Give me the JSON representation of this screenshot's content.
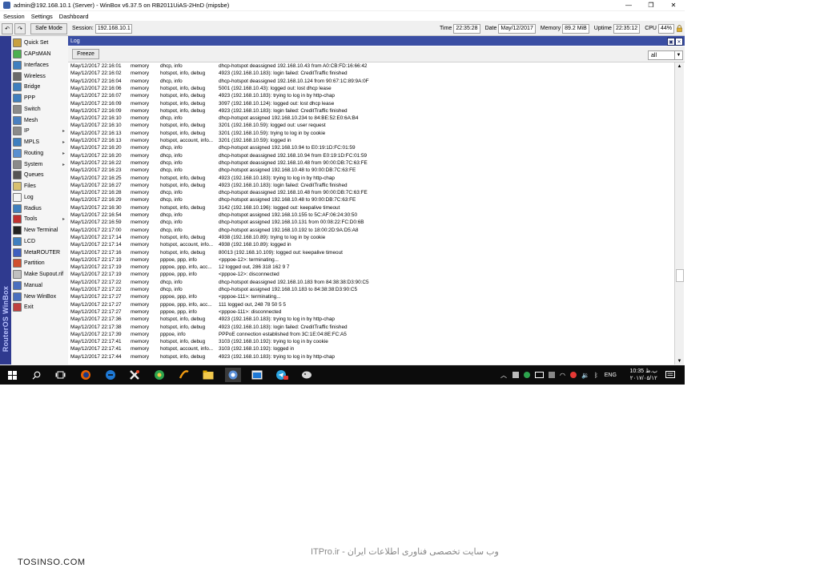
{
  "window": {
    "title": "admin@192.168.10.1 (Server) - WinBox v6.37.5 on RB2011UiAS-2HnD (mipsbe)",
    "min_glyph": "—",
    "max_glyph": "❐",
    "close_glyph": "✕"
  },
  "menubar": [
    "Session",
    "Settings",
    "Dashboard"
  ],
  "toolbar": {
    "undo_glyph": "↶",
    "redo_glyph": "↷",
    "safe_mode": "Safe Mode",
    "session_label": "Session:",
    "session_value": "192.168.10.1",
    "time_label": "Time",
    "time_value": "22:35:28",
    "date_label": "Date",
    "date_value": "May/12/2017",
    "memory_label": "Memory",
    "memory_value": "89.2 MiB",
    "uptime_label": "Uptime",
    "uptime_value": "22:35:12",
    "cpu_label": "CPU",
    "cpu_value": "44%"
  },
  "sidebar": {
    "brand": "RouterOS WinBox",
    "items": [
      {
        "label": "Quick Set",
        "color": "#c8a040",
        "arrow": false
      },
      {
        "label": "CAPsMAN",
        "color": "#4caf50",
        "arrow": false
      },
      {
        "label": "Interfaces",
        "color": "#3f7fbf",
        "arrow": false
      },
      {
        "label": "Wireless",
        "color": "#6a6a6a",
        "arrow": false
      },
      {
        "label": "Bridge",
        "color": "#3f7fbf",
        "arrow": false
      },
      {
        "label": "PPP",
        "color": "#3f7fbf",
        "arrow": false
      },
      {
        "label": "Switch",
        "color": "#8a8a8a",
        "arrow": false
      },
      {
        "label": "Mesh",
        "color": "#4a7fbf",
        "arrow": false
      },
      {
        "label": "IP",
        "color": "#8a8a8a",
        "arrow": true
      },
      {
        "label": "MPLS",
        "color": "#3f7fbf",
        "arrow": true
      },
      {
        "label": "Routing",
        "color": "#5a8fd0",
        "arrow": true
      },
      {
        "label": "System",
        "color": "#8a8a8a",
        "arrow": true
      },
      {
        "label": "Queues",
        "color": "#555555",
        "arrow": false
      },
      {
        "label": "Files",
        "color": "#d8c070",
        "arrow": false
      },
      {
        "label": "Log",
        "color": "#f4f4f4",
        "arrow": false
      },
      {
        "label": "Radius",
        "color": "#3f7fbf",
        "arrow": false
      },
      {
        "label": "Tools",
        "color": "#c03030",
        "arrow": true
      },
      {
        "label": "New Terminal",
        "color": "#222222",
        "arrow": false
      },
      {
        "label": "LCD",
        "color": "#3f7fbf",
        "arrow": false
      },
      {
        "label": "MetaROUTER",
        "color": "#3f5fbf",
        "arrow": false
      },
      {
        "label": "Partition",
        "color": "#d05030",
        "arrow": false
      },
      {
        "label": "Make Supout.rif",
        "color": "#c0c0c0",
        "arrow": false
      },
      {
        "label": "Manual",
        "color": "#4a6fbf",
        "arrow": false
      },
      {
        "label": "New WinBox",
        "color": "#4a6fbf",
        "arrow": false
      },
      {
        "label": "Exit",
        "color": "#c04040",
        "arrow": false
      }
    ]
  },
  "log": {
    "title": "Log",
    "freeze": "Freeze",
    "filter": "all",
    "dropdown_glyph": "▼",
    "restore_glyph": "▣",
    "close_glyph": "✕",
    "scroll_up_glyph": "▲",
    "scroll_down_glyph": "▼",
    "rows": [
      [
        "May/12/2017 22:16:01",
        "memory",
        "dhcp, info",
        "dhcp-hotspot deassigned 192.168.10.43 from A0:CB:FD:16:66:42"
      ],
      [
        "May/12/2017 22:16:02",
        "memory",
        "hotspot, info, debug",
        "4923 (192.168.10.183): login failed: CreditTraffic finished"
      ],
      [
        "May/12/2017 22:16:04",
        "memory",
        "dhcp, info",
        "dhcp-hotspot deassigned 192.168.10.124 from 90:67:1C:89:9A:0F"
      ],
      [
        "May/12/2017 22:16:06",
        "memory",
        "hotspot, info, debug",
        "5001 (192.168.10.43): logged out: lost dhcp lease"
      ],
      [
        "May/12/2017 22:16:07",
        "memory",
        "hotspot, info, debug",
        "4923 (192.168.10.183): trying to log in by http-chap"
      ],
      [
        "May/12/2017 22:16:09",
        "memory",
        "hotspot, info, debug",
        "3097 (192.168.10.124): logged out: lost dhcp lease"
      ],
      [
        "May/12/2017 22:16:09",
        "memory",
        "hotspot, info, debug",
        "4923 (192.168.10.183): login failed: CreditTraffic finished"
      ],
      [
        "May/12/2017 22:16:10",
        "memory",
        "dhcp, info",
        "dhcp-hotspot assigned 192.168.10.234 to 84:BE:52:E0:6A:B4"
      ],
      [
        "May/12/2017 22:16:10",
        "memory",
        "hotspot, info, debug",
        "3201 (192.168.10.59): logged out: user request"
      ],
      [
        "May/12/2017 22:16:13",
        "memory",
        "hotspot, info, debug",
        "3201 (192.168.10.59): trying to log in by cookie"
      ],
      [
        "May/12/2017 22:16:13",
        "memory",
        "hotspot, account, info...",
        "3201 (192.168.10.59): logged in"
      ],
      [
        "May/12/2017 22:16:20",
        "memory",
        "dhcp, info",
        "dhcp-hotspot assigned 192.168.10.94 to E0:19:1D:FC:01:59"
      ],
      [
        "May/12/2017 22:16:20",
        "memory",
        "dhcp, info",
        "dhcp-hotspot deassigned 192.168.10.94 from E0:19:1D:FC:01:59"
      ],
      [
        "May/12/2017 22:16:22",
        "memory",
        "dhcp, info",
        "dhcp-hotspot deassigned 192.168.10.48 from 90:00:DB:7C:63:FE"
      ],
      [
        "May/12/2017 22:16:23",
        "memory",
        "dhcp, info",
        "dhcp-hotspot assigned 192.168.10.48 to 90:00:DB:7C:63:FE"
      ],
      [
        "May/12/2017 22:16:25",
        "memory",
        "hotspot, info, debug",
        "4923 (192.168.10.183): trying to log in by http-chap"
      ],
      [
        "May/12/2017 22:16:27",
        "memory",
        "hotspot, info, debug",
        "4923 (192.168.10.183): login failed: CreditTraffic finished"
      ],
      [
        "May/12/2017 22:16:28",
        "memory",
        "dhcp, info",
        "dhcp-hotspot deassigned 192.168.10.48 from 90:00:DB:7C:63:FE"
      ],
      [
        "May/12/2017 22:16:29",
        "memory",
        "dhcp, info",
        "dhcp-hotspot assigned 192.168.10.48 to 90:00:DB:7C:63:FE"
      ],
      [
        "May/12/2017 22:16:30",
        "memory",
        "hotspot, info, debug",
        "3142 (192.168.10.196): logged out: keepalive timeout"
      ],
      [
        "May/12/2017 22:16:54",
        "memory",
        "dhcp, info",
        "dhcp-hotspot assigned 192.168.10.155 to 5C:AF:06:24:30:50"
      ],
      [
        "May/12/2017 22:16:59",
        "memory",
        "dhcp, info",
        "dhcp-hotspot assigned 192.168.10.131 from 00:08:22:FC:D0:6B"
      ],
      [
        "May/12/2017 22:17:00",
        "memory",
        "dhcp, info",
        "dhcp-hotspot assigned 192.168.10.192 to 18:00:2D:9A:D5:A8"
      ],
      [
        "May/12/2017 22:17:14",
        "memory",
        "hotspot, info, debug",
        "4938 (192.168.10.89): trying to log in by cookie"
      ],
      [
        "May/12/2017 22:17:14",
        "memory",
        "hotspot, account, info...",
        "4938 (192.168.10.89): logged in"
      ],
      [
        "May/12/2017 22:17:16",
        "memory",
        "hotspot, info, debug",
        "80013 (192.168.10.109): logged out: keepalive timeout"
      ],
      [
        "May/12/2017 22:17:19",
        "memory",
        "pppoe, ppp, info",
        "<pppoe-12>: terminating..."
      ],
      [
        "May/12/2017 22:17:19",
        "memory",
        "pppoe, ppp, info, acc...",
        "12 logged out, 286 318 162 9 7"
      ],
      [
        "May/12/2017 22:17:19",
        "memory",
        "pppoe, ppp, info",
        "<pppoe-12>: disconnected"
      ],
      [
        "May/12/2017 22:17:22",
        "memory",
        "dhcp, info",
        "dhcp-hotspot deassigned 192.168.10.183 from 84:38:38:D3:90:C5"
      ],
      [
        "May/12/2017 22:17:22",
        "memory",
        "dhcp, info",
        "dhcp-hotspot assigned 192.168.10.183 to 84:38:38:D3:90:C5"
      ],
      [
        "May/12/2017 22:17:27",
        "memory",
        "pppoe, ppp, info",
        "<pppoe-111>: terminating..."
      ],
      [
        "May/12/2017 22:17:27",
        "memory",
        "pppoe, ppp, info, acc...",
        "111 logged out, 248 78 50 5 5"
      ],
      [
        "May/12/2017 22:17:27",
        "memory",
        "pppoe, ppp, info",
        "<pppoe-111>: disconnected"
      ],
      [
        "May/12/2017 22:17:36",
        "memory",
        "hotspot, info, debug",
        "4923 (192.168.10.183): trying to log in by http-chap"
      ],
      [
        "May/12/2017 22:17:38",
        "memory",
        "hotspot, info, debug",
        "4923 (192.168.10.183): login failed: CreditTraffic finished"
      ],
      [
        "May/12/2017 22:17:39",
        "memory",
        "pppoe, info",
        "PPPoE connection established from 3C:1E:04:8E:FC:A5"
      ],
      [
        "May/12/2017 22:17:41",
        "memory",
        "hotspot, info, debug",
        "3103 (192.168.10.192): trying to log in by cookie"
      ],
      [
        "May/12/2017 22:17:41",
        "memory",
        "hotspot, account, info...",
        "3103 (192.168.10.192): logged in"
      ],
      [
        "May/12/2017 22:17:44",
        "memory",
        "hotspot, info, debug",
        "4923 (192.168.10.183): trying to log in by http-chap"
      ]
    ]
  },
  "taskbar": {
    "language": "ENG",
    "clock_time": "10:35 ب.ظ",
    "clock_date": "۲۰۱۷/۰۵/۱۲"
  },
  "watermarks": {
    "left": "TOSINSO.COM",
    "center": "ITPro.ir - وب سایت تخصصی فناوری اطلاعات ایران"
  }
}
